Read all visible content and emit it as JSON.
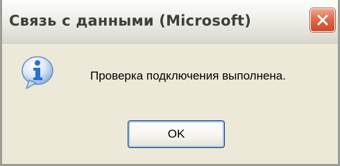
{
  "dialog": {
    "title": "Связь с данными (Microsoft)",
    "message": "Проверка подключения выполнена.",
    "ok_label": "OK",
    "icon": "info-icon",
    "close_icon": "close-icon"
  },
  "colors": {
    "face": "#ece9d8",
    "close_button": "#d95f3e",
    "button_border": "#003c74",
    "icon_blue": "#2a6fd6"
  }
}
